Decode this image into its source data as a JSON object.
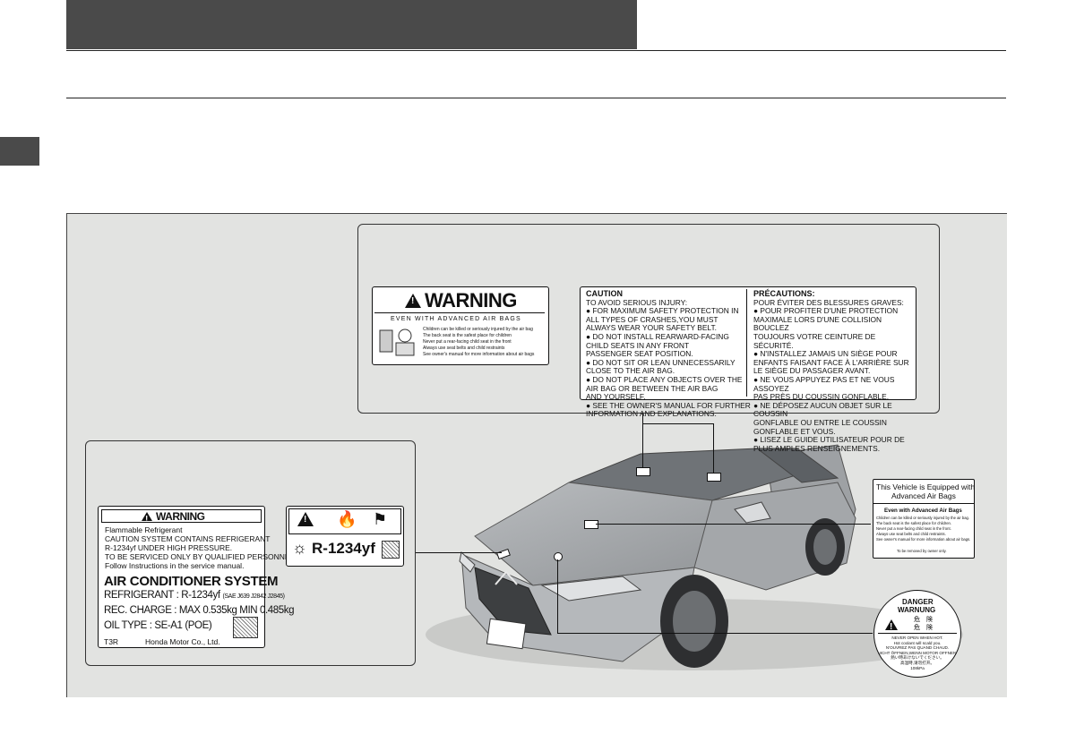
{
  "airbag_warning": {
    "title": "WARNING",
    "subtitle": "EVEN WITH ADVANCED AIR BAGS",
    "bullets": [
      "Children can be killed or seriously injured by the air bag",
      "The back seat is the safest place for children",
      "Never put a rear-facing child seat in the front",
      "Always use seat belts and child restraints",
      "See owner's manual for more information about air bags"
    ]
  },
  "caution_en": {
    "title": "CAUTION",
    "lines": [
      "TO AVOID SERIOUS INJURY:",
      "● FOR MAXIMUM SAFETY PROTECTION IN",
      "   ALL TYPES OF CRASHES,YOU MUST",
      "   ALWAYS WEAR YOUR SAFETY BELT.",
      "● DO NOT INSTALL REARWARD-FACING",
      "   CHILD SEATS IN ANY FRONT",
      "   PASSENGER SEAT POSITION.",
      "● DO NOT SIT OR LEAN UNNECESSARILY",
      "   CLOSE TO THE AIR BAG.",
      "● DO NOT PLACE ANY OBJECTS OVER THE",
      "   AIR BAG OR BETWEEN THE AIR BAG",
      "   AND YOURSELF.",
      "● SEE THE OWNER'S MANUAL FOR FURTHER",
      "   INFORMATION AND EXPLANATIONS."
    ]
  },
  "caution_fr": {
    "title": "PRÉCAUTIONS:",
    "lines": [
      "POUR ÉVITER DES BLESSURES GRAVES:",
      "● POUR PROFITER D'UNE PROTECTION",
      "   MAXIMALE LORS D'UNE COLLISION BOUCLEZ",
      "   TOUJOURS VOTRE CEINTURE DE SÉCURITÉ.",
      "● N'INSTALLEZ JAMAIS UN SIÈGE POUR",
      "   ENFANTS FAISANT FACE À L'ARRIÈRE SUR",
      "   LE SIÈGE DU PASSAGER AVANT.",
      "● NE VOUS APPUYEZ PAS ET NE VOUS ASSOYEZ",
      "   PAS PRÈS DU COUSSIN GONFLABLE.",
      "● NE DÉPOSEZ AUCUN OBJET SUR LE COUSSIN",
      "   GONFLABLE OU ENTRE LE COUSSIN",
      "   GONFLABLE ET VOUS.",
      "● LISEZ LE GUIDE UTILISATEUR POUR DE",
      "   PLUS AMPLES RENSEIGNEMENTS."
    ]
  },
  "ac_label": {
    "title": "WARNING",
    "lines": [
      "Flammable Refrigerant",
      "CAUTION SYSTEM CONTAINS REFRIGERANT",
      "R-1234yf UNDER HIGH PRESSURE.",
      "TO BE SERVICED ONLY BY QUALIFIED PERSONNEL.",
      "Follow Instructions in the service manual."
    ],
    "system": "AIR CONDITIONER SYSTEM",
    "refrigerant": "REFRIGERANT : R-1234yf",
    "refrigerant_std": "(SAE J639 J2842 J2845)",
    "charge": "REC. CHARGE : MAX 0.535kg  MIN 0.485kg",
    "oil": "OIL TYPE : SE-A1 (POE)",
    "code": "T3R",
    "maker": "Honda Motor Co., Ltd."
  },
  "refrigerant_label": {
    "name": "R-1234yf"
  },
  "advanced_airbag_label": {
    "title_line1": "This Vehicle is Equipped with",
    "title_line2": "Advanced Air Bags",
    "subtitle": "Even with Advanced Air Bags",
    "lines": [
      "Children can be killed or seriously injured by the air bag.",
      "The back seat is the safest place for children.",
      "Never put a rear-facing child seat in the front.",
      "Always use seat belts and child restraints.",
      "See owner's manual for more information about air bags."
    ],
    "footer": "To be removed by owner only."
  },
  "radiator_cap_label": {
    "danger": "DANGER",
    "warnung": "WARNUNG",
    "jp1": "危　険",
    "jp2": "危　険",
    "lines": [
      "NEVER OPEN WHEN HOT.",
      "Hot coolant will scald you.",
      "N'OUVREZ PAS QUAND CHAUD.",
      "NICHT ÖFFNEN,WENN MOTOR OFFNEN.",
      "熱い時あけないでください。",
      "高温時,请勿打开。"
    ],
    "pressure": "108kPa"
  },
  "colors": {
    "header": "#4a4a4a",
    "figure_bg": "#e2e3e1"
  }
}
